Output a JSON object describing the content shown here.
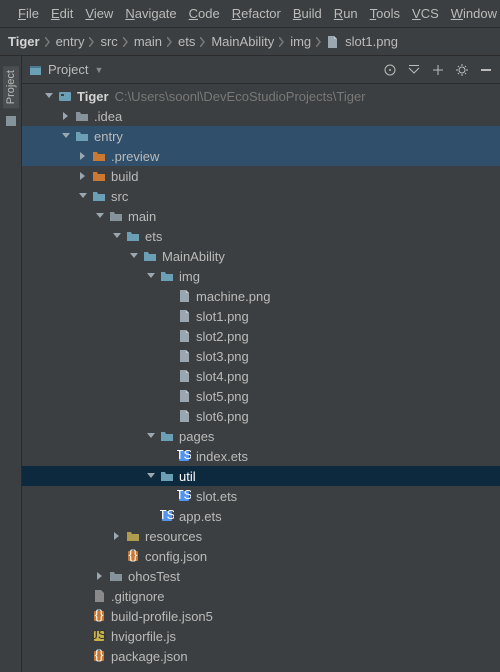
{
  "menu": {
    "items": [
      "File",
      "Edit",
      "View",
      "Navigate",
      "Code",
      "Refactor",
      "Build",
      "Run",
      "Tools",
      "VCS",
      "Window"
    ]
  },
  "breadcrumb": {
    "root": "Tiger",
    "parts": [
      "entry",
      "src",
      "main",
      "ets",
      "MainAbility",
      "img",
      "slot1.png"
    ]
  },
  "toolwindow": {
    "project_label": "Project"
  },
  "panel": {
    "title": "Project"
  },
  "tree": {
    "root": {
      "name": "Tiger",
      "path": "C:\\Users\\soonl\\DevEcoStudioProjects\\Tiger"
    },
    "nodes": [
      {
        "d": 0,
        "t": "root"
      },
      {
        "d": 1,
        "t": "folder-gray",
        "n": ".idea",
        "a": "r"
      },
      {
        "d": 1,
        "t": "folder-blue",
        "n": "entry",
        "a": "d",
        "hovered": true
      },
      {
        "d": 2,
        "t": "folder-orange",
        "n": ".preview",
        "a": "r",
        "hovered": true
      },
      {
        "d": 2,
        "t": "folder-orange",
        "n": "build",
        "a": "r"
      },
      {
        "d": 2,
        "t": "folder-blue",
        "n": "src",
        "a": "d"
      },
      {
        "d": 3,
        "t": "folder-gray",
        "n": "main",
        "a": "d"
      },
      {
        "d": 4,
        "t": "folder-blue",
        "n": "ets",
        "a": "d"
      },
      {
        "d": 5,
        "t": "folder-blue",
        "n": "MainAbility",
        "a": "d"
      },
      {
        "d": 6,
        "t": "folder-blue",
        "n": "img",
        "a": "d"
      },
      {
        "d": 7,
        "t": "png",
        "n": "machine.png"
      },
      {
        "d": 7,
        "t": "png",
        "n": "slot1.png"
      },
      {
        "d": 7,
        "t": "png",
        "n": "slot2.png"
      },
      {
        "d": 7,
        "t": "png",
        "n": "slot3.png"
      },
      {
        "d": 7,
        "t": "png",
        "n": "slot4.png"
      },
      {
        "d": 7,
        "t": "png",
        "n": "slot5.png"
      },
      {
        "d": 7,
        "t": "png",
        "n": "slot6.png"
      },
      {
        "d": 6,
        "t": "folder-blue",
        "n": "pages",
        "a": "d"
      },
      {
        "d": 7,
        "t": "ets",
        "n": "index.ets"
      },
      {
        "d": 6,
        "t": "folder-blue",
        "n": "util",
        "a": "d",
        "selected": true
      },
      {
        "d": 7,
        "t": "ets",
        "n": "slot.ets"
      },
      {
        "d": 6,
        "t": "ets",
        "n": "app.ets"
      },
      {
        "d": 4,
        "t": "folder-yellow",
        "n": "resources",
        "a": "r"
      },
      {
        "d": 4,
        "t": "json",
        "n": "config.json"
      },
      {
        "d": 3,
        "t": "folder-gray",
        "n": "ohosTest",
        "a": "r"
      },
      {
        "d": 2,
        "t": "git",
        "n": ".gitignore"
      },
      {
        "d": 2,
        "t": "json",
        "n": "build-profile.json5"
      },
      {
        "d": 2,
        "t": "js",
        "n": "hvigorfile.js"
      },
      {
        "d": 2,
        "t": "json",
        "n": "package.json"
      }
    ]
  }
}
